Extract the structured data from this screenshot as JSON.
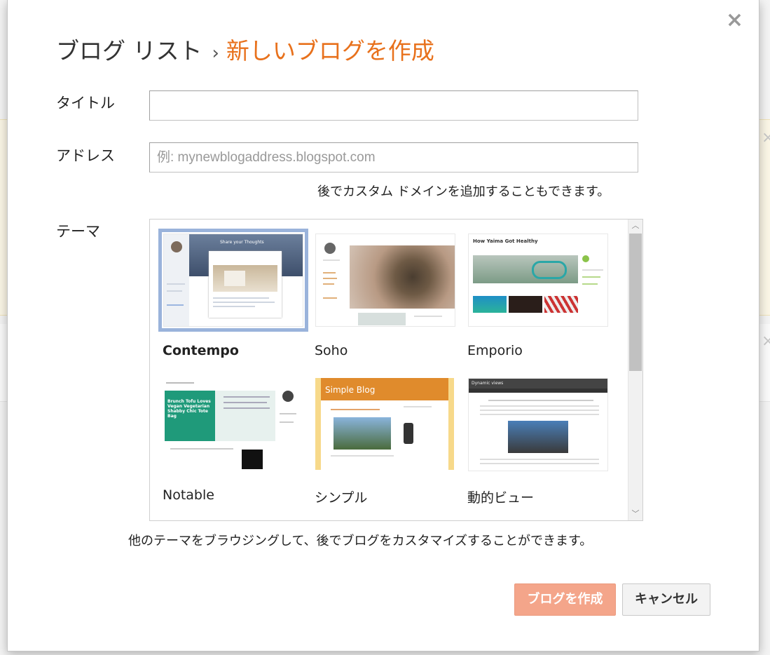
{
  "dialog": {
    "breadcrumb": {
      "parent": "ブログ リスト",
      "separator": "›",
      "current": "新しいブログを作成"
    },
    "close_symbol": "×",
    "title_field": {
      "label": "タイトル",
      "value": "",
      "placeholder": ""
    },
    "address_field": {
      "label": "アドレス",
      "value": "",
      "placeholder": "例: mynewblogaddress.blogspot.com",
      "hint": "後でカスタム ドメインを追加することもできます。"
    },
    "theme_section": {
      "label": "テーマ",
      "selected": "Contempo",
      "themes": [
        {
          "name": "Contempo",
          "selected": true
        },
        {
          "name": "Soho",
          "selected": false
        },
        {
          "name": "Emporio",
          "selected": false
        },
        {
          "name": "Notable",
          "selected": false
        },
        {
          "name": "シンプル",
          "selected": false
        },
        {
          "name": "動的ビュー",
          "selected": false
        }
      ],
      "thumb_text": {
        "contempo": "Share your Thoughts",
        "emporio": "How Yaima Got Healthy",
        "notable": "Brunch Tofu Loves Vegan Vegetarian Shabby Chic Tote Bag",
        "simple": "Simple Blog",
        "dynamic": "Dynamic views"
      },
      "footer_hint": "他のテーマをブラウジングして、後でブログをカスタマイズすることができます。"
    },
    "buttons": {
      "create": "ブログを作成",
      "cancel": "キャンセル"
    }
  },
  "colors": {
    "accent_orange": "#e8711c",
    "create_button": "#f4a58a",
    "selection_outline": "#9ab3db"
  }
}
